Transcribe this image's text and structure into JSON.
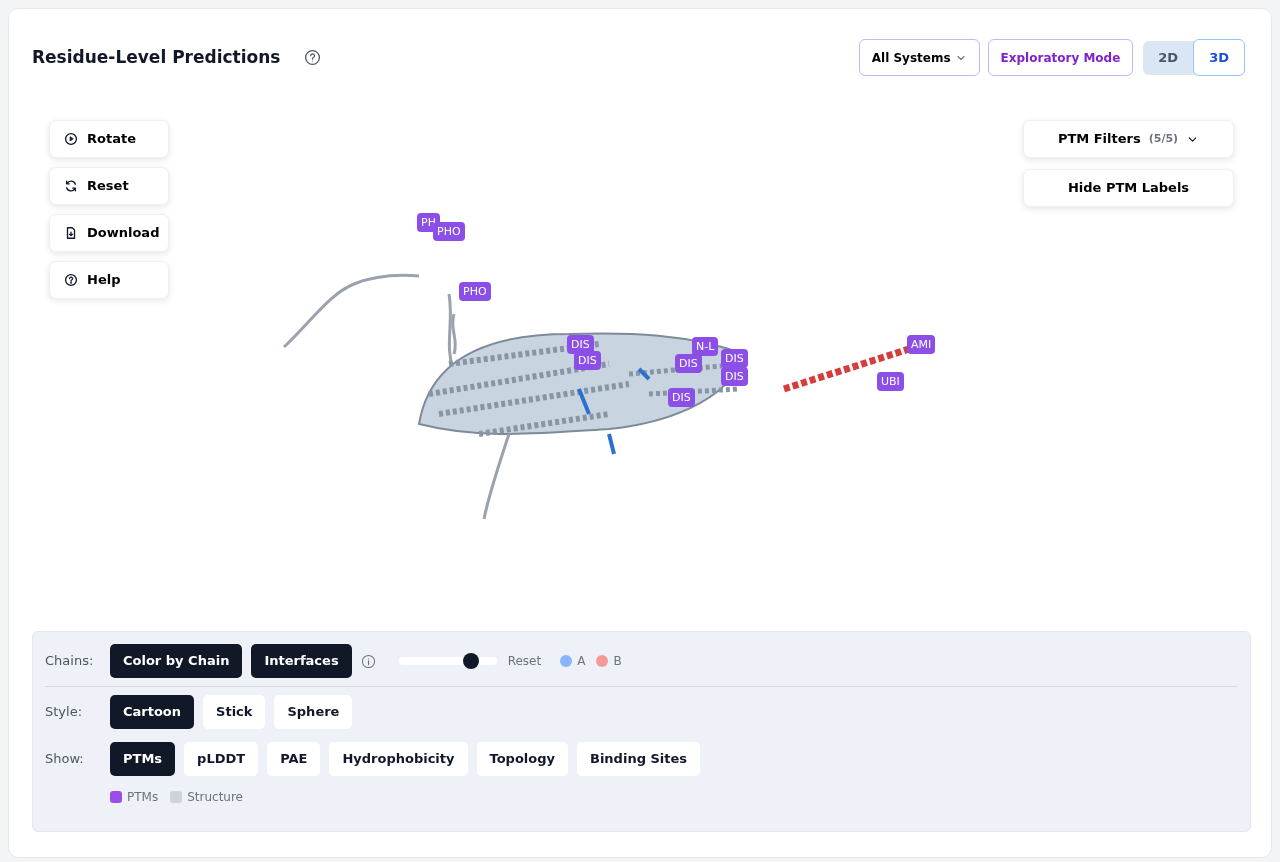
{
  "header": {
    "title": "Residue-Level Predictions",
    "system_select": "All Systems",
    "mode_button": "Exploratory Mode",
    "view_toggle": [
      {
        "label": "2D",
        "selected": false
      },
      {
        "label": "3D",
        "selected": true
      }
    ]
  },
  "tools": [
    {
      "label": "Rotate",
      "kind": "play"
    },
    {
      "label": "Reset",
      "kind": "refresh"
    },
    {
      "label": "Download",
      "kind": "file"
    },
    {
      "label": "Help",
      "kind": "help"
    }
  ],
  "ptm_filters": {
    "label": "PTM Filters",
    "count": "(5/5)"
  },
  "hide_labels_button": "Hide PTM Labels",
  "ptm_labels": [
    "PH",
    "PHO",
    "PHO",
    "DIS",
    "DIS",
    "N-L",
    "DIS",
    "DIS",
    "DIS",
    "DIS",
    "AMI",
    "UBI"
  ],
  "controls": {
    "chains": {
      "label": "Chains:",
      "options": [
        {
          "label": "Color by Chain",
          "selected": true
        },
        {
          "label": "Interfaces",
          "selected": true
        }
      ],
      "slider": {
        "level": 0.74
      },
      "reset": "Reset",
      "legend": [
        {
          "label": "A",
          "color": "#8ab4f8"
        },
        {
          "label": "B",
          "color": "#f59a9a"
        }
      ]
    },
    "style": {
      "label": "Style:",
      "options": [
        {
          "label": "Cartoon",
          "selected": true
        },
        {
          "label": "Stick",
          "selected": false
        },
        {
          "label": "Sphere",
          "selected": false
        }
      ]
    },
    "show": {
      "label": "Show:",
      "options": [
        {
          "label": "PTMs",
          "selected": true
        },
        {
          "label": "pLDDT",
          "selected": false
        },
        {
          "label": "PAE",
          "selected": false
        },
        {
          "label": "Hydrophobicity",
          "selected": false
        },
        {
          "label": "Topology",
          "selected": false
        },
        {
          "label": "Binding Sites",
          "selected": false
        }
      ],
      "legend": [
        {
          "label": "PTMs",
          "color": "#9b4dea"
        },
        {
          "label": "Structure",
          "color": "#cdd3dd"
        }
      ]
    }
  }
}
